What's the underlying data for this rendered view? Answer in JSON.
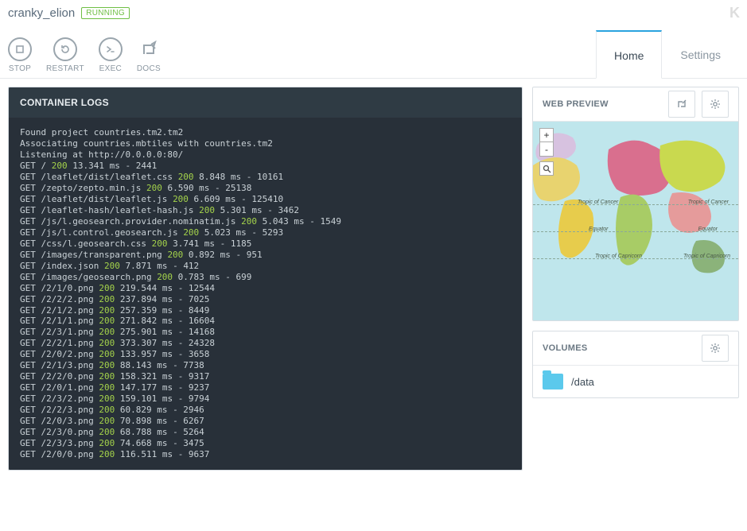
{
  "header": {
    "container_name": "cranky_elion",
    "status": "RUNNING"
  },
  "actions": {
    "stop": "STOP",
    "restart": "RESTART",
    "exec": "EXEC",
    "docs": "DOCS"
  },
  "tabs": {
    "home": "Home",
    "settings": "Settings"
  },
  "panels": {
    "logs_title": "CONTAINER LOGS",
    "web_preview_title": "WEB PREVIEW",
    "volumes_title": "VOLUMES"
  },
  "map": {
    "zoom_in": "+",
    "zoom_out": "-",
    "labels": {
      "tropic_cancer": "Tropic of Cancer",
      "equator": "Equator",
      "tropic_capricorn": "Tropic of Capricorn"
    }
  },
  "volumes": [
    {
      "path": "/data"
    }
  ],
  "logs": {
    "preamble": [
      "Found project countries.tm2.tm2",
      "Associating countries.mbtiles with countries.tm2",
      "Listening at http://0.0.0.0:80/"
    ],
    "lines": [
      {
        "m": "GET",
        "p": "/",
        "s": "200",
        "rest": "13.341 ms - 2441"
      },
      {
        "m": "GET",
        "p": "/leaflet/dist/leaflet.css",
        "s": "200",
        "rest": "8.848 ms - 10161"
      },
      {
        "m": "GET",
        "p": "/zepto/zepto.min.js",
        "s": "200",
        "rest": "6.590 ms - 25138"
      },
      {
        "m": "GET",
        "p": "/leaflet/dist/leaflet.js",
        "s": "200",
        "rest": "6.609 ms - 125410"
      },
      {
        "m": "GET",
        "p": "/leaflet-hash/leaflet-hash.js",
        "s": "200",
        "rest": "5.301 ms - 3462"
      },
      {
        "m": "GET",
        "p": "/js/l.geosearch.provider.nominatim.js",
        "s": "200",
        "rest": "5.043 ms - 1549"
      },
      {
        "m": "GET",
        "p": "/js/l.control.geosearch.js",
        "s": "200",
        "rest": "5.023 ms - 5293"
      },
      {
        "m": "GET",
        "p": "/css/l.geosearch.css",
        "s": "200",
        "rest": "3.741 ms - 1185"
      },
      {
        "m": "GET",
        "p": "/images/transparent.png",
        "s": "200",
        "rest": "0.892 ms - 951"
      },
      {
        "m": "GET",
        "p": "/index.json",
        "s": "200",
        "rest": "7.871 ms - 412"
      },
      {
        "m": "GET",
        "p": "/images/geosearch.png",
        "s": "200",
        "rest": "0.783 ms - 699"
      },
      {
        "m": "GET",
        "p": "/2/1/0.png",
        "s": "200",
        "rest": "219.544 ms - 12544"
      },
      {
        "m": "GET",
        "p": "/2/2/2.png",
        "s": "200",
        "rest": "237.894 ms - 7025"
      },
      {
        "m": "GET",
        "p": "/2/1/2.png",
        "s": "200",
        "rest": "257.359 ms - 8449"
      },
      {
        "m": "GET",
        "p": "/2/1/1.png",
        "s": "200",
        "rest": "271.842 ms - 16604"
      },
      {
        "m": "GET",
        "p": "/2/3/1.png",
        "s": "200",
        "rest": "275.901 ms - 14168"
      },
      {
        "m": "GET",
        "p": "/2/2/1.png",
        "s": "200",
        "rest": "373.307 ms - 24328"
      },
      {
        "m": "GET",
        "p": "/2/0/2.png",
        "s": "200",
        "rest": "133.957 ms - 3658"
      },
      {
        "m": "GET",
        "p": "/2/1/3.png",
        "s": "200",
        "rest": "88.143 ms - 7738"
      },
      {
        "m": "GET",
        "p": "/2/2/0.png",
        "s": "200",
        "rest": "158.321 ms - 9317"
      },
      {
        "m": "GET",
        "p": "/2/0/1.png",
        "s": "200",
        "rest": "147.177 ms - 9237"
      },
      {
        "m": "GET",
        "p": "/2/3/2.png",
        "s": "200",
        "rest": "159.101 ms - 9794"
      },
      {
        "m": "GET",
        "p": "/2/2/3.png",
        "s": "200",
        "rest": "60.829 ms - 2946"
      },
      {
        "m": "GET",
        "p": "/2/0/3.png",
        "s": "200",
        "rest": "70.898 ms - 6267"
      },
      {
        "m": "GET",
        "p": "/2/3/0.png",
        "s": "200",
        "rest": "68.788 ms - 5264"
      },
      {
        "m": "GET",
        "p": "/2/3/3.png",
        "s": "200",
        "rest": "74.668 ms - 3475"
      },
      {
        "m": "GET",
        "p": "/2/0/0.png",
        "s": "200",
        "rest": "116.511 ms - 9637"
      }
    ]
  }
}
